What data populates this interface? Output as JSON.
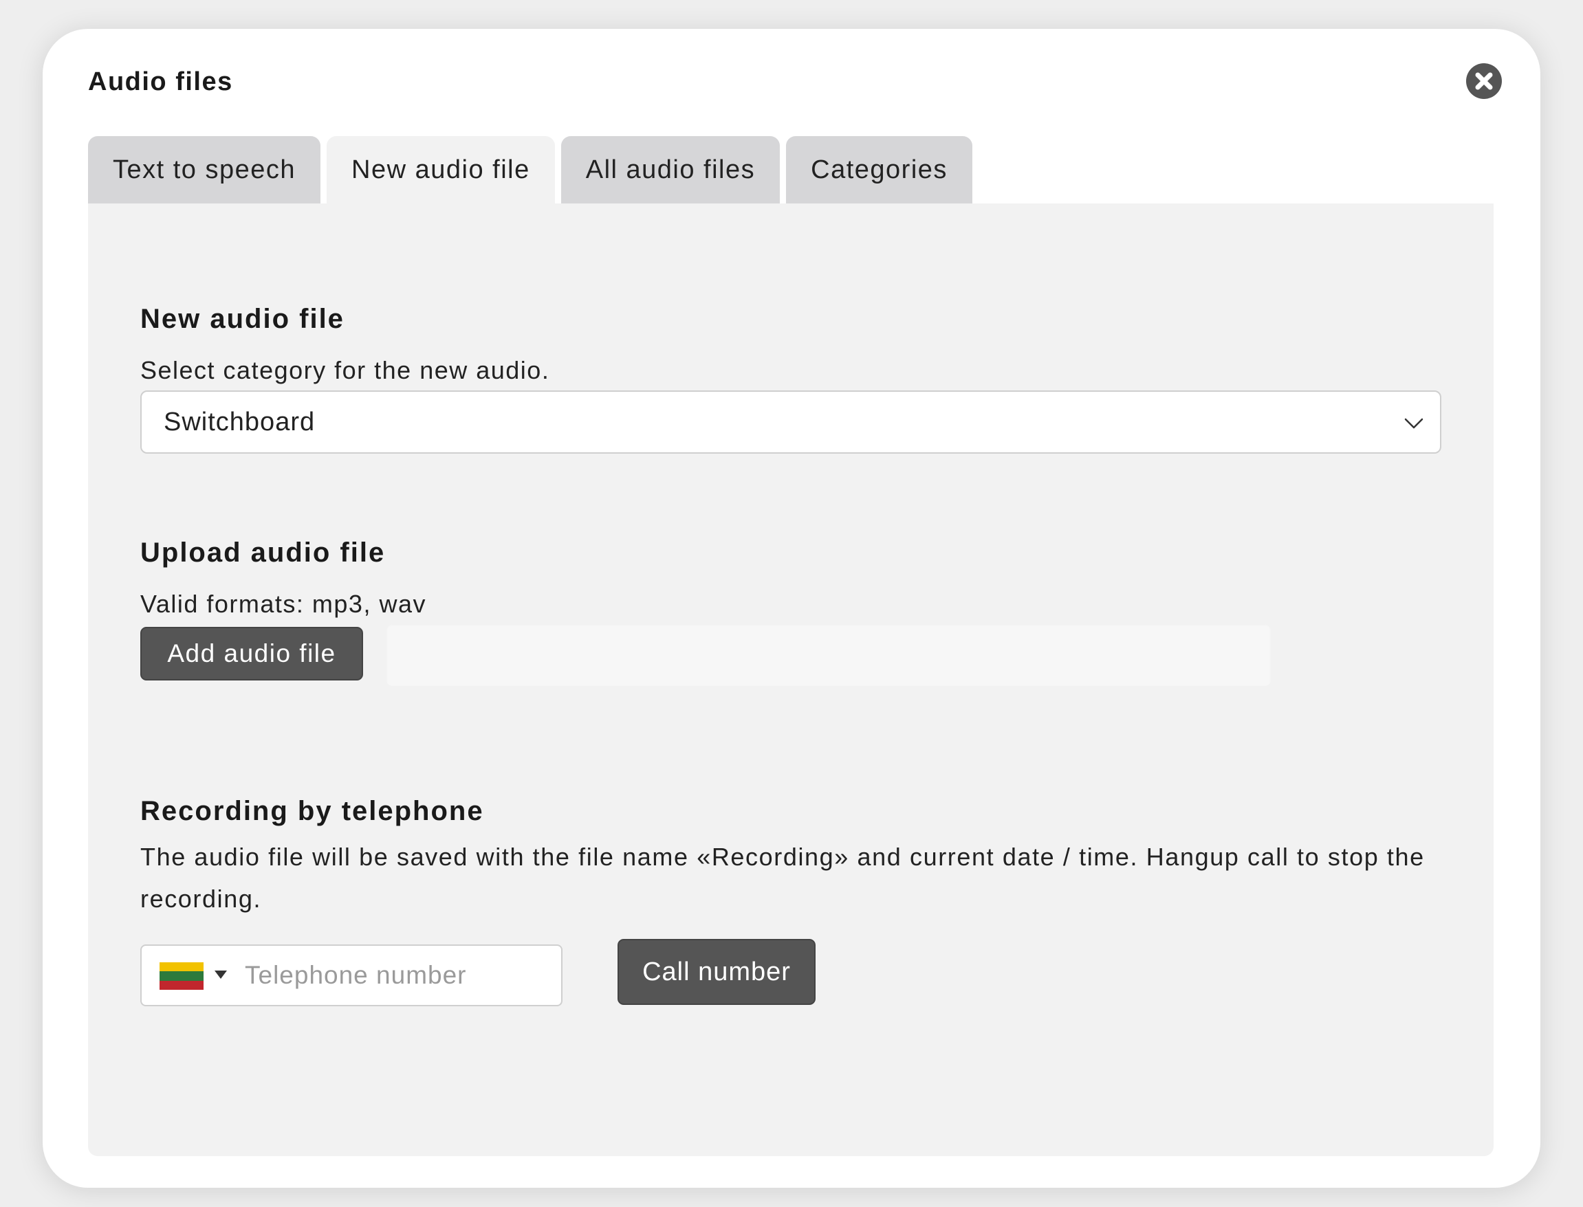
{
  "modal": {
    "title": "Audio files"
  },
  "tabs": [
    {
      "label": "Text to speech",
      "active": false
    },
    {
      "label": "New audio file",
      "active": true
    },
    {
      "label": "All audio files",
      "active": false
    },
    {
      "label": "Categories",
      "active": false
    }
  ],
  "new_audio": {
    "title": "New audio file",
    "hint": "Select category for the new audio.",
    "category_selected": "Switchboard"
  },
  "upload": {
    "title": "Upload audio file",
    "hint": "Valid formats: mp3, wav",
    "button_label": "Add audio file",
    "file_name": ""
  },
  "recording": {
    "title": "Recording by telephone",
    "description": "The audio file will be saved with the file name «Recording» and current date / time. Hangup call to stop the recording.",
    "phone_placeholder": "Telephone number",
    "phone_value": "",
    "call_button_label": "Call number",
    "flag_colors": [
      "#f2c200",
      "#2d7a3c",
      "#c1272d"
    ]
  },
  "colors": {
    "button_bg": "#555555",
    "panel_bg": "#f2f2f2",
    "tab_inactive_bg": "#d6d6d8"
  }
}
